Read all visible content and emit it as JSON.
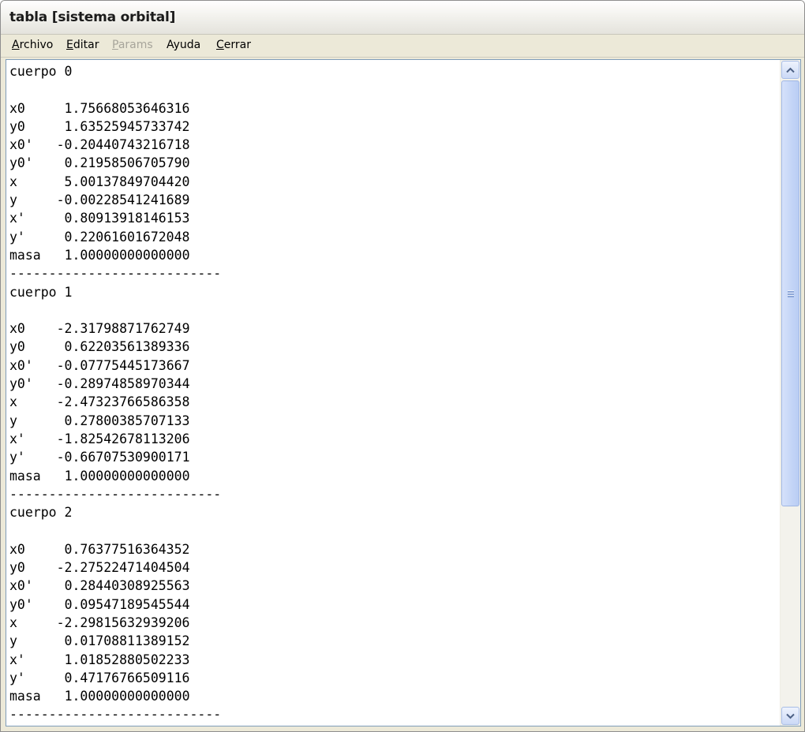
{
  "window": {
    "title": "tabla [sistema orbital]"
  },
  "menu": [
    {
      "accel": "A",
      "rest": "rchivo",
      "disabled": false
    },
    {
      "accel": "E",
      "rest": "ditar",
      "disabled": false
    },
    {
      "accel": "P",
      "rest": "arams",
      "disabled": true
    },
    {
      "accel": "",
      "rest": "Ayuda",
      "disabled": false
    },
    {
      "accel": "C",
      "rest": "errar",
      "disabled": false
    }
  ],
  "text": {
    "bodies": [
      {
        "header": "cuerpo 0",
        "rows": [
          {
            "label": "x0",
            "value": "1.75668053646316"
          },
          {
            "label": "y0",
            "value": "1.63525945733742"
          },
          {
            "label": "x0'",
            "value": "-0.20440743216718"
          },
          {
            "label": "y0'",
            "value": "0.21958506705790"
          },
          {
            "label": "x",
            "value": "5.00137849704420"
          },
          {
            "label": "y",
            "value": "-0.00228541241689"
          },
          {
            "label": "x'",
            "value": "0.80913918146153"
          },
          {
            "label": "y'",
            "value": "0.22061601672048"
          },
          {
            "label": "masa",
            "value": "1.00000000000000"
          }
        ],
        "separator": "---------------------------"
      },
      {
        "header": "cuerpo 1",
        "rows": [
          {
            "label": "x0",
            "value": "-2.31798871762749"
          },
          {
            "label": "y0",
            "value": "0.62203561389336"
          },
          {
            "label": "x0'",
            "value": "-0.07775445173667"
          },
          {
            "label": "y0'",
            "value": "-0.28974858970344"
          },
          {
            "label": "x",
            "value": "-2.47323766586358"
          },
          {
            "label": "y",
            "value": "0.27800385707133"
          },
          {
            "label": "x'",
            "value": "-1.82542678113206"
          },
          {
            "label": "y'",
            "value": "-0.66707530900171"
          },
          {
            "label": "masa",
            "value": "1.00000000000000"
          }
        ],
        "separator": "---------------------------"
      },
      {
        "header": "cuerpo 2",
        "rows": [
          {
            "label": "x0",
            "value": "0.76377516364352"
          },
          {
            "label": "y0",
            "value": "-2.27522471404504"
          },
          {
            "label": "x0'",
            "value": "0.28440308925563"
          },
          {
            "label": "y0'",
            "value": "0.09547189545544"
          },
          {
            "label": "x",
            "value": "-2.29815632939206"
          },
          {
            "label": "y",
            "value": "0.01708811389152"
          },
          {
            "label": "x'",
            "value": "1.01852880502233"
          },
          {
            "label": "y'",
            "value": "0.47176766509116"
          },
          {
            "label": "masa",
            "value": "1.00000000000000"
          }
        ],
        "separator": "---------------------------"
      }
    ]
  },
  "icons": {
    "scroll_up": "arrow-up-icon",
    "scroll_down": "arrow-down-icon",
    "thumb_grip": "grip-icon"
  },
  "colors": {
    "text_border": "#7f9db9",
    "scroll_arrow": "#4d6185"
  }
}
